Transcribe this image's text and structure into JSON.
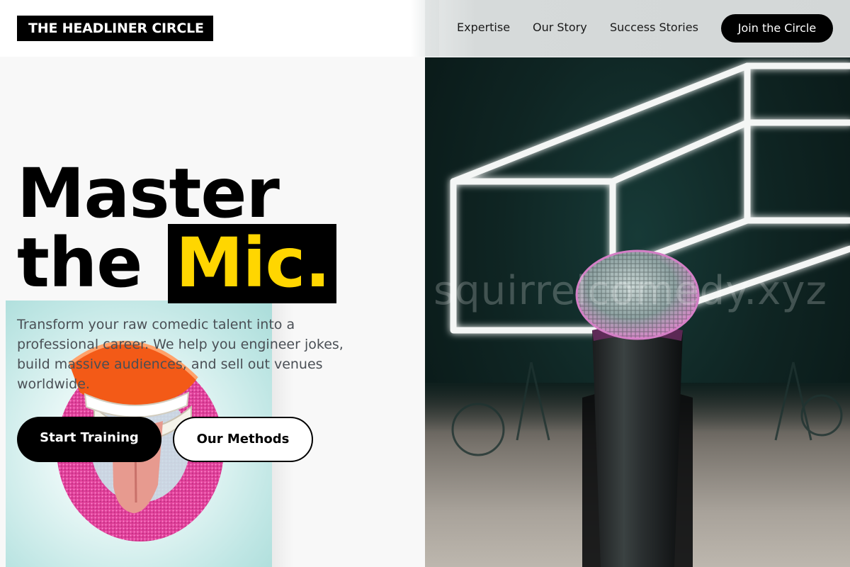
{
  "brand": {
    "logo_text": "THE HEADLINER CIRCLE"
  },
  "nav": {
    "links": [
      {
        "label": "Expertise"
      },
      {
        "label": "Our Story"
      },
      {
        "label": "Success Stories"
      }
    ],
    "cta_label": "Join the Circle"
  },
  "hero": {
    "headline_line1": "Master",
    "headline_line2_plain": "the",
    "headline_highlight": "Mic.",
    "subcopy": "Transform your raw comedic talent into a professional career. We help you engineer jokes, build massive audiences, and sell out venues worldwide.",
    "primary_button": "Start Training",
    "secondary_button": "Our Methods"
  },
  "images": {
    "stage_photo_watermark": "squirrelcomedy.xyz",
    "left_photo_subject": "wind-up chattering teeth toy"
  },
  "colors": {
    "accent": "#ffd600",
    "ink": "#000000",
    "background": "#f8f8f8",
    "body_text": "#4a4f55"
  }
}
